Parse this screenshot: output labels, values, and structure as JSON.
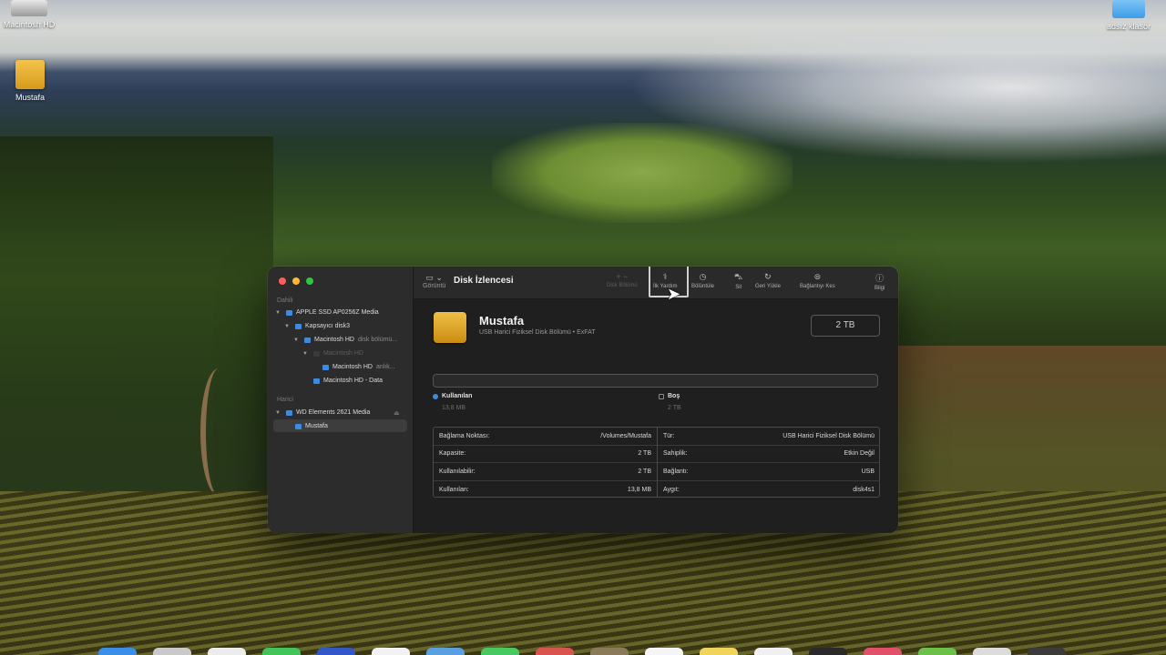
{
  "desktop": {
    "icons": [
      {
        "label": "Macintosh HD"
      },
      {
        "label": "Mustafa"
      },
      {
        "label": "adsız klasör"
      }
    ]
  },
  "window": {
    "title": "Disk İzlencesi",
    "toolbar": {
      "view_label": "Görüntü",
      "buttons": [
        {
          "label": "Disk Bölümü",
          "icon": "partition-icon",
          "enabled": false
        },
        {
          "label": "İlk Yardım",
          "icon": "first-aid-icon",
          "enabled": true
        },
        {
          "label": "Bölüntüle",
          "icon": "clock-icon",
          "enabled": true
        },
        {
          "label": "Sil",
          "icon": "erase-icon",
          "enabled": true
        },
        {
          "label": "Geri Yükle",
          "icon": "restore-icon",
          "enabled": true
        },
        {
          "label": "Bağlantıyı Kes",
          "icon": "unmount-icon",
          "enabled": true
        },
        {
          "label": "Bilgi",
          "icon": "info-icon",
          "enabled": true
        }
      ]
    },
    "sidebar": {
      "section_internal": "Dahili",
      "section_external": "Harici",
      "items": [
        {
          "label": "APPLE SSD AP0256Z Media",
          "extra": ""
        },
        {
          "label": "Kapsayıcı disk3",
          "extra": ""
        },
        {
          "label": "Macintosh HD",
          "extra": "disk bölümü..."
        },
        {
          "label": "Macintosh HD",
          "extra": ""
        },
        {
          "label": "Macintosh HD",
          "extra": "anlık..."
        },
        {
          "label": "Macintosh HD - Data",
          "extra": ""
        },
        {
          "label": "WD Elements 2621 Media",
          "extra": ""
        },
        {
          "label": "Mustafa",
          "extra": ""
        }
      ]
    },
    "volume": {
      "name": "Mustafa",
      "subtitle": "USB Harici Fiziksel Disk Bölümü • ExFAT",
      "size": "2 TB",
      "used_label": "Kullanılan",
      "used_value": "13,8 MB",
      "free_label": "Boş",
      "free_value": "2 TB",
      "used_fraction": 0.0
    },
    "info_left": [
      {
        "k": "Bağlama Noktası:",
        "v": "/Volumes/Mustafa"
      },
      {
        "k": "Kapasite:",
        "v": "2 TB"
      },
      {
        "k": "Kullanılabilir:",
        "v": "2 TB"
      },
      {
        "k": "Kullanılan:",
        "v": "13,8 MB"
      }
    ],
    "info_right": [
      {
        "k": "Tür:",
        "v": "USB Harici Fiziksel Disk Bölümü"
      },
      {
        "k": "Sahiplik:",
        "v": "Etkin Değil"
      },
      {
        "k": "Bağlantı:",
        "v": "USB"
      },
      {
        "k": "Aygıt:",
        "v": "disk4s1"
      }
    ]
  },
  "dock_colors": [
    "#3a8ee8",
    "#c9c9c9",
    "#ececec",
    "#43c45a",
    "#3357c9",
    "#f2f2f2",
    "#5aa0e0",
    "#48c860",
    "#d9534f",
    "#8a7a5a",
    "#f5f5f5",
    "#efd35a",
    "#f0f0f0",
    "#2a2a2a",
    "#e0506a",
    "#6cc04a",
    "#dcdcdc",
    "#3b3b3b"
  ]
}
